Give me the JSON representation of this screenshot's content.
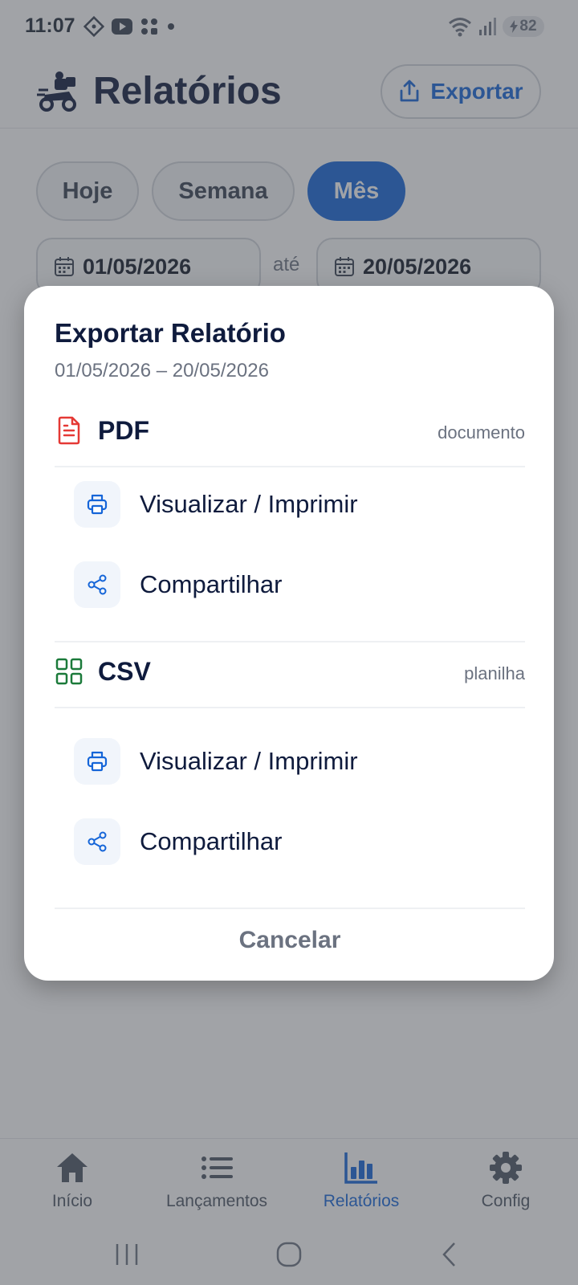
{
  "status_bar": {
    "time": "11:07",
    "battery": "82"
  },
  "header": {
    "title": "Relatórios",
    "export_label": "Exportar"
  },
  "filters": {
    "chips": [
      {
        "label": "Hoje",
        "active": false
      },
      {
        "label": "Semana",
        "active": false
      },
      {
        "label": "Mês",
        "active": true
      }
    ],
    "date_from": "01/05/2026",
    "date_separator": "até",
    "date_to": "20/05/2026"
  },
  "dialog": {
    "title": "Exportar Relatório",
    "range": "01/05/2026 – 20/05/2026",
    "sections": [
      {
        "label": "PDF",
        "kind": "documento",
        "icon": "file-text-icon",
        "actions": [
          {
            "label": "Visualizar / Imprimir",
            "icon": "printer-icon"
          },
          {
            "label": "Compartilhar",
            "icon": "share-icon"
          }
        ]
      },
      {
        "label": "CSV",
        "kind": "planilha",
        "icon": "grid-icon",
        "actions": [
          {
            "label": "Visualizar / Imprimir",
            "icon": "printer-icon"
          },
          {
            "label": "Compartilhar",
            "icon": "share-icon"
          }
        ]
      }
    ],
    "cancel_label": "Cancelar"
  },
  "bottom_nav": {
    "items": [
      {
        "label": "Início",
        "icon": "home-icon",
        "active": false
      },
      {
        "label": "Lançamentos",
        "icon": "list-icon",
        "active": false
      },
      {
        "label": "Relatórios",
        "icon": "bar-chart-icon",
        "active": true
      },
      {
        "label": "Config",
        "icon": "gear-icon",
        "active": false
      }
    ]
  },
  "colors": {
    "accent": "#1565d8",
    "title": "#0f1b3d",
    "pdf_icon": "#e53935",
    "csv_icon": "#1b7a3a"
  }
}
